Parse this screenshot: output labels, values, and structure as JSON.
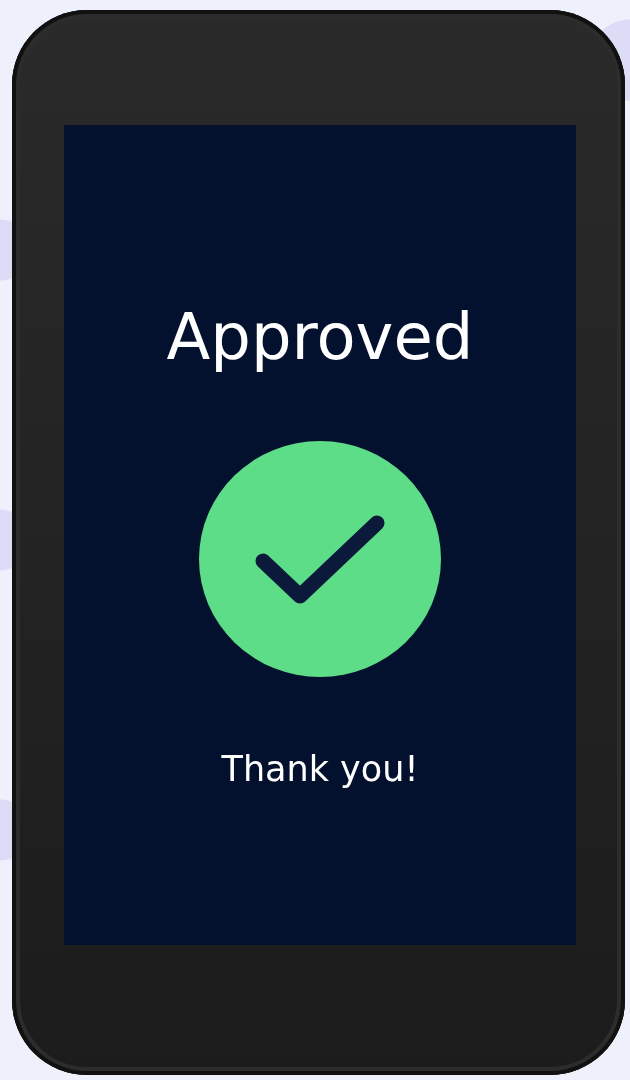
{
  "screen": {
    "title": "Approved",
    "kind": "approved",
    "message": "Thank you!"
  }
}
